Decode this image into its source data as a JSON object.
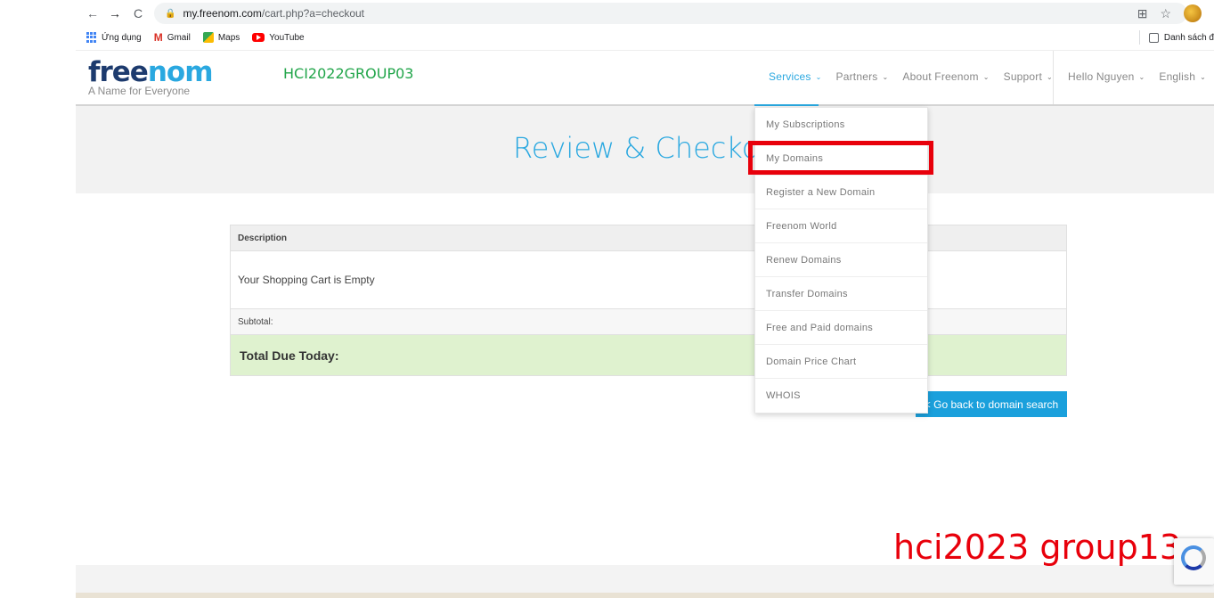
{
  "browser": {
    "url_host": "my.freenom.com",
    "url_path": "/cart.php?a=checkout",
    "bookmarks": [
      {
        "label": "Ứng dụng"
      },
      {
        "label": "Gmail"
      },
      {
        "label": "Maps"
      },
      {
        "label": "YouTube"
      }
    ],
    "reading_list": "Danh sách đ"
  },
  "header": {
    "logo_free": "free",
    "logo_nom": "nom",
    "tagline": "A Name for Everyone",
    "group_label": "HCI2022GROUP03",
    "nav": [
      {
        "label": "Services"
      },
      {
        "label": "Partners"
      },
      {
        "label": "About Freenom"
      },
      {
        "label": "Support"
      }
    ],
    "user_menu": "Hello Nguyen",
    "language": "English"
  },
  "hero": {
    "title": "Review & Checkout"
  },
  "cart": {
    "col_description": "Description",
    "empty_message": "Your Shopping Cart is Empty",
    "subtotal_label": "Subtotal:",
    "total_label": "Total Due Today:",
    "back_button": "< Go back to domain search"
  },
  "services_dropdown": {
    "items": [
      {
        "label": "My Subscriptions"
      },
      {
        "label": "My Domains"
      },
      {
        "label": "Register a New Domain"
      },
      {
        "label": "Freenom World"
      },
      {
        "label": "Renew Domains"
      },
      {
        "label": "Transfer Domains"
      },
      {
        "label": "Free and Paid domains"
      },
      {
        "label": "Domain Price Chart"
      },
      {
        "label": "WHOIS"
      }
    ]
  },
  "annotation": {
    "watermark": "hci2023 group13"
  },
  "colors": {
    "brand_blue": "#2aa8e0",
    "highlight_red": "#e8000b",
    "group_green": "#21a54a"
  }
}
